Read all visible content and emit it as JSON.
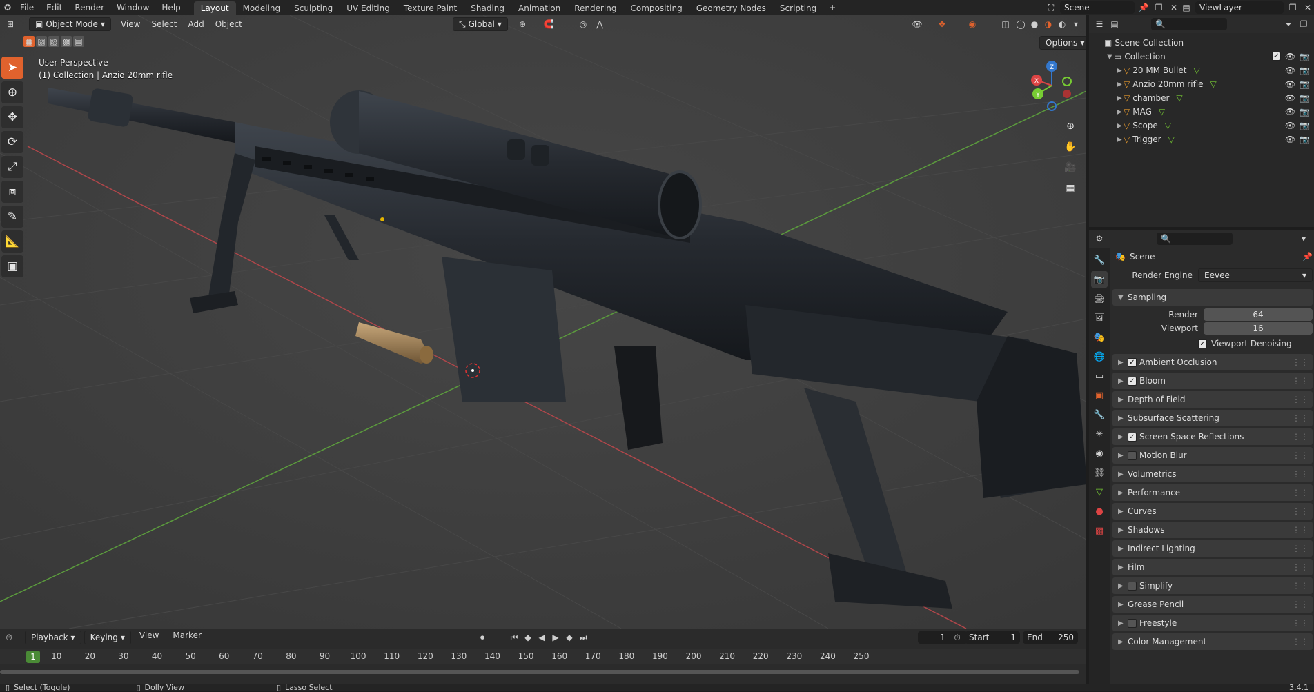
{
  "topbar": {
    "menus": [
      "File",
      "Edit",
      "Render",
      "Window",
      "Help"
    ],
    "workspaces": [
      "Layout",
      "Modeling",
      "Sculpting",
      "UV Editing",
      "Texture Paint",
      "Shading",
      "Animation",
      "Rendering",
      "Compositing",
      "Geometry Nodes",
      "Scripting"
    ],
    "active_workspace": "Layout",
    "scene": "Scene",
    "view_layer": "ViewLayer"
  },
  "viewport": {
    "mode": "Object Mode",
    "menus": [
      "View",
      "Select",
      "Add",
      "Object"
    ],
    "orientation": "Global",
    "options_label": "Options",
    "info_line1": "User Perspective",
    "info_line2": "(1) Collection | Anzio 20mm rifle",
    "gizmo_axes": [
      "X",
      "Y",
      "Z"
    ]
  },
  "outliner": {
    "root": "Scene Collection",
    "collection": "Collection",
    "objects": [
      "20 MM Bullet",
      "Anzio 20mm rifle",
      "chamber",
      "MAG",
      "Scope",
      "Trigger"
    ]
  },
  "properties": {
    "context": "Scene",
    "render_engine_label": "Render Engine",
    "render_engine": "Eevee",
    "sampling": {
      "title": "Sampling",
      "render_label": "Render",
      "render_value": "64",
      "viewport_label": "Viewport",
      "viewport_value": "16",
      "denoise_label": "Viewport Denoising",
      "denoise_checked": true
    },
    "panels": [
      {
        "label": "Ambient Occlusion",
        "checkbox": true,
        "checked": true
      },
      {
        "label": "Bloom",
        "checkbox": true,
        "checked": true
      },
      {
        "label": "Depth of Field",
        "checkbox": false,
        "checked": false
      },
      {
        "label": "Subsurface Scattering",
        "checkbox": false,
        "checked": false
      },
      {
        "label": "Screen Space Reflections",
        "checkbox": true,
        "checked": true
      },
      {
        "label": "Motion Blur",
        "checkbox": true,
        "checked": false
      },
      {
        "label": "Volumetrics",
        "checkbox": false,
        "checked": false
      },
      {
        "label": "Performance",
        "checkbox": false,
        "checked": false
      },
      {
        "label": "Curves",
        "checkbox": false,
        "checked": false
      },
      {
        "label": "Shadows",
        "checkbox": false,
        "checked": false
      },
      {
        "label": "Indirect Lighting",
        "checkbox": false,
        "checked": false
      },
      {
        "label": "Film",
        "checkbox": false,
        "checked": false
      },
      {
        "label": "Simplify",
        "checkbox": true,
        "checked": false
      },
      {
        "label": "Grease Pencil",
        "checkbox": false,
        "checked": false
      },
      {
        "label": "Freestyle",
        "checkbox": true,
        "checked": false
      },
      {
        "label": "Color Management",
        "checkbox": false,
        "checked": false
      }
    ]
  },
  "timeline": {
    "menus": [
      "Playback",
      "Keying",
      "View",
      "Marker"
    ],
    "current_frame": "1",
    "start_label": "Start",
    "start": "1",
    "end_label": "End",
    "end": "250",
    "ticks": [
      "10",
      "20",
      "30",
      "40",
      "50",
      "60",
      "70",
      "80",
      "90",
      "100",
      "110",
      "120",
      "130",
      "140",
      "150",
      "160",
      "170",
      "180",
      "190",
      "200",
      "210",
      "220",
      "230",
      "240",
      "250"
    ]
  },
  "statusbar": {
    "select": "Select (Toggle)",
    "dolly": "Dolly View",
    "lasso": "Lasso Select",
    "version": "3.4.1"
  },
  "colors": {
    "accent": "#e0622d",
    "frame": "#4a8a36",
    "x_axis": "#d44",
    "y_axis": "#7c3",
    "z_axis": "#37c"
  }
}
